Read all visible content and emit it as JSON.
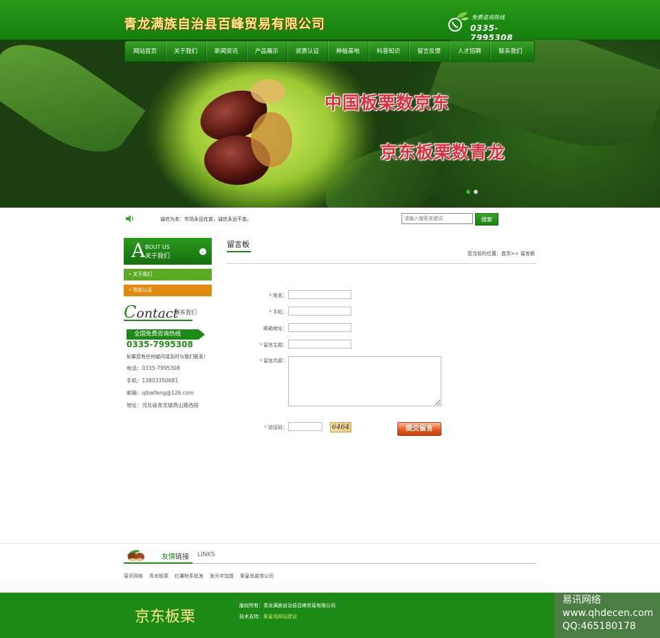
{
  "header": {
    "site_title": "青龙满族自治县百峰贸易有限公司",
    "hotline_label": "免费咨询热线",
    "hotline_number": "0335-7995308"
  },
  "nav": {
    "items": [
      "网站首页",
      "关于我们",
      "新闻资讯",
      "产品展示",
      "资质认证",
      "种植基地",
      "科普知识",
      "留言反馈",
      "人才招聘",
      "联系我们"
    ]
  },
  "banner": {
    "line1": "中国板栗数京东",
    "line2": "京东板栗数青龙"
  },
  "notice": {
    "text": "诚信为本：市场永远在变，诚信永远不变。"
  },
  "search": {
    "placeholder": "请输入搜索关键词",
    "button_label": "搜索"
  },
  "sidebar": {
    "about_letter": "A",
    "about_en": "BOUT US",
    "about_cn": "关于我们",
    "items": [
      "关于我们",
      "资质认证"
    ],
    "contact_title_letter": "C",
    "contact_title_rest": "ontact",
    "contact_sub": "联系我们",
    "free_call_label": "全国免费咨询热线",
    "phone_big": "0335-7995308",
    "note": "如果您有任何疑问请及时与我们联系！",
    "phone_line": "电话：0335-7995308",
    "mobile_line": "手机：13803350681",
    "email_line": "邮箱：qlbaifeng@126.com",
    "address_line": "地址：河北省青龙镇燕山路西段"
  },
  "content": {
    "title": "留言板",
    "breadcrumb": "您当前的位置：首页>> 留言板"
  },
  "form": {
    "name_label": "姓名：",
    "phone_label": "手机：",
    "email_label": "邮箱地址：",
    "subject_label": "留言主题：",
    "content_label": "留言内容：",
    "captcha_label": "验证码：",
    "captcha_code": "6464",
    "submit_label": "提交留言",
    "required_mark": "*"
  },
  "links": {
    "title_green": "友情",
    "title_dark": "链接",
    "title_en": "LINKS",
    "items": [
      "易讯网络",
      "青龙板栗",
      "红薯粉条批发",
      "发光字加盟",
      "秦皇岛装饰公司"
    ]
  },
  "footer": {
    "brand": "京东板栗",
    "copyright": "版权所有：青龙满族自治县百峰贸易有限公司",
    "support_prefix": "技术支持：",
    "support_link": "秦皇岛网站建设"
  },
  "watermark": {
    "line1": "易讯网络",
    "line2": "www.qhdecen.com",
    "line3": "QQ:465180178"
  },
  "colors": {
    "brand_green": "#1e8a16",
    "title_gold": "#ffe98a",
    "banner_red": "#e03040",
    "orange_item": "#e08a10"
  }
}
